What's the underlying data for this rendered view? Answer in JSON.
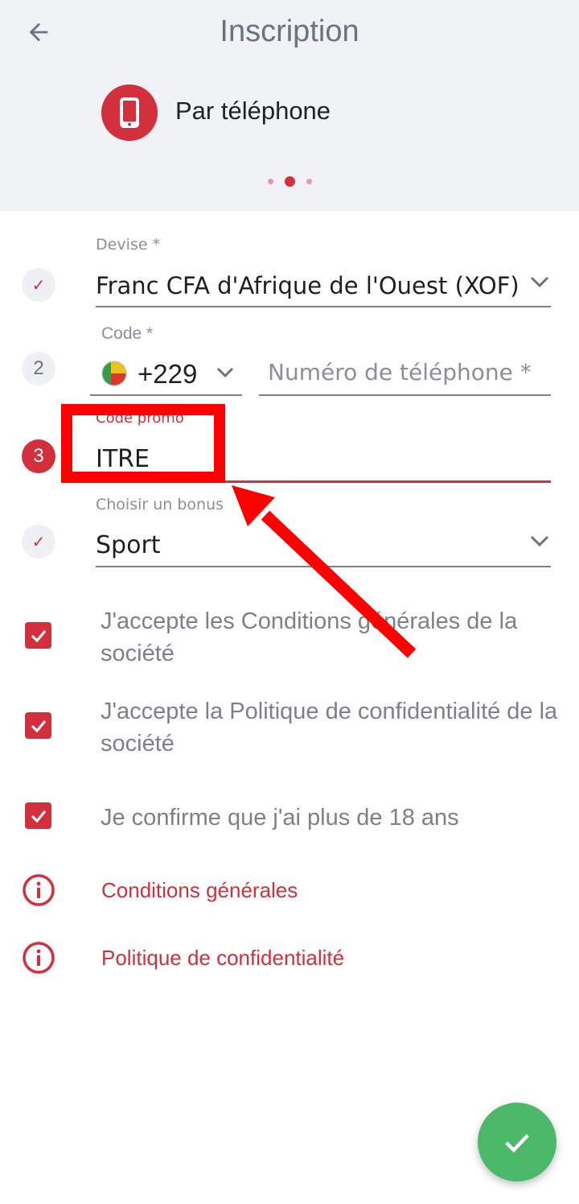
{
  "header": {
    "title": "Inscription",
    "method_label": "Par téléphone",
    "icons": {
      "back": "arrow-left-icon",
      "method": "phone-icon"
    },
    "stepper": {
      "total": 3,
      "active": 2
    }
  },
  "form": {
    "currency": {
      "step": "✓",
      "label": "Devise *",
      "value": "Franc CFA d'Afrique de l'Ouest (XOF)"
    },
    "phone": {
      "step": "2",
      "code_label": "Code *",
      "code_value": "+229",
      "flag": "benin-flag-icon",
      "number_placeholder": "Numéro de téléphone *"
    },
    "promo": {
      "step": "3",
      "label": "Code promo",
      "value": "ITRE"
    },
    "bonus": {
      "step": "✓",
      "label": "Choisir un bonus",
      "value": "Sport"
    }
  },
  "agreements": [
    {
      "text": "J'accepte les Conditions générales de la société",
      "checked": true
    },
    {
      "text": "J'accepte la Politique de confidentialité de la société",
      "checked": true
    },
    {
      "text": "Je confirme que j'ai plus de 18 ans",
      "checked": true
    }
  ],
  "links": [
    {
      "text": "Conditions générales",
      "icon": "info-icon"
    },
    {
      "text": "Politique de confidentialité",
      "icon": "info-icon"
    }
  ],
  "fab": {
    "icon": "check-icon"
  },
  "colors": {
    "accent": "#d32f3c",
    "success": "#4cb86a",
    "annotation": "#ff0000",
    "header_bg": "#f0f2f5"
  }
}
